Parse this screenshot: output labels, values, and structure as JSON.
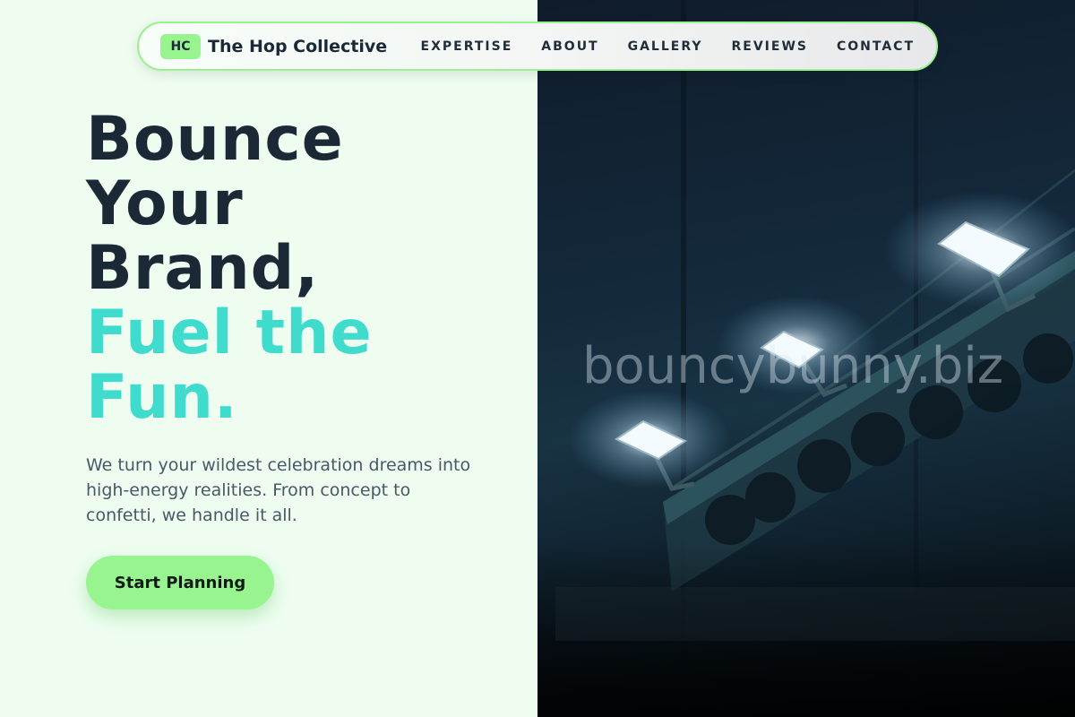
{
  "brand": {
    "badge": "HC",
    "name": "The Hop Collective",
    "accent_color": "#98f48e"
  },
  "nav": {
    "links": [
      "EXPERTISE",
      "ABOUT",
      "GALLERY",
      "REVIEWS",
      "CONTACT"
    ]
  },
  "hero": {
    "title_lines": [
      "Bounce",
      "Your",
      "Brand,"
    ],
    "title_accent_lines": [
      "Fuel the",
      "Fun."
    ],
    "accent_color": "#3fdccd",
    "subtitle": "We turn your wildest celebration dreams into high-energy realities. From concept to confetti, we handle it all.",
    "cta_label": "Start Planning"
  },
  "image": {
    "watermark": "bouncybunny.biz",
    "description_icon": "stage-lights-image"
  }
}
